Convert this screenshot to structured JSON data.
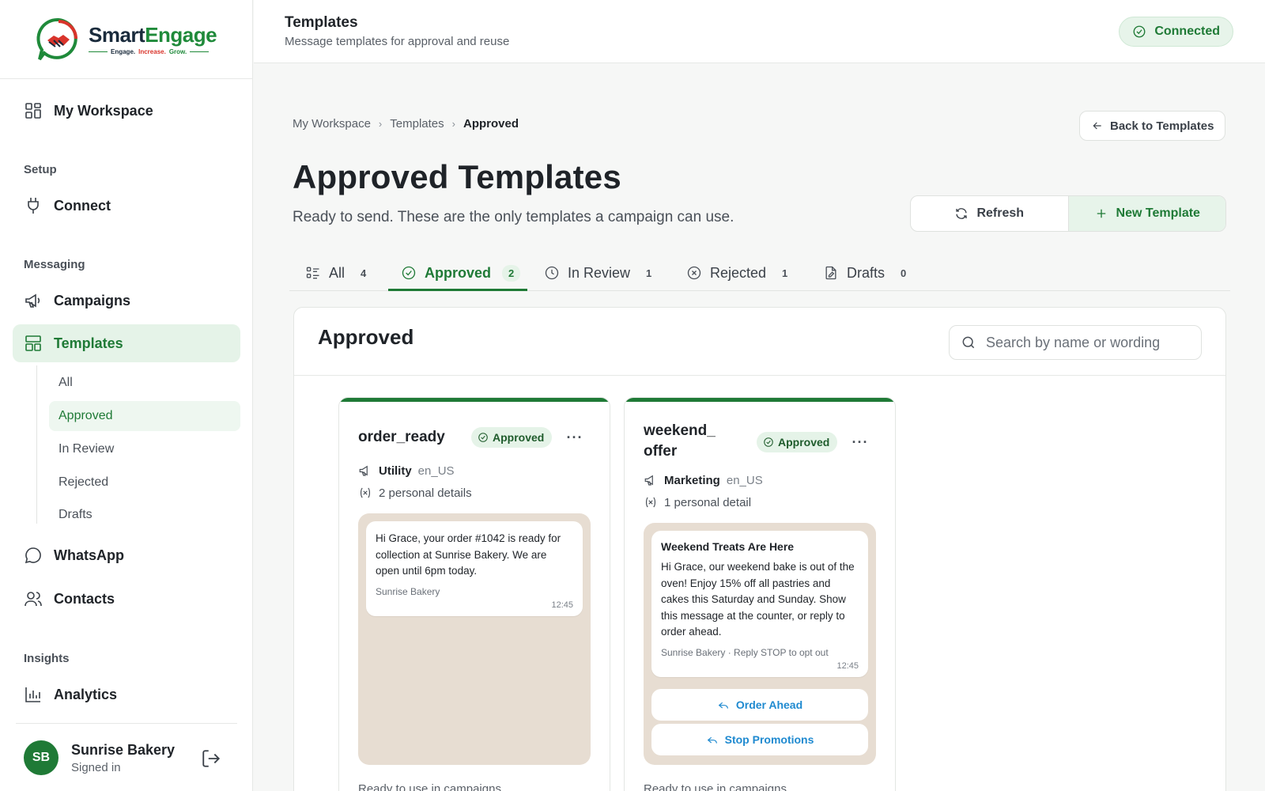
{
  "brand": {
    "name_part1": "Smart",
    "name_part2": "Engage",
    "tag_1": "Engage.",
    "tag_2": "Increase.",
    "tag_3": "Grow."
  },
  "sidebar": {
    "workspace": "My Workspace",
    "sections": {
      "setup": "Setup",
      "messaging": "Messaging",
      "insights": "Insights"
    },
    "items": {
      "connect": "Connect",
      "campaigns": "Campaigns",
      "templates": "Templates",
      "whatsapp": "WhatsApp",
      "contacts": "Contacts",
      "analytics": "Analytics"
    },
    "sub_items": [
      "All",
      "Approved",
      "In Review",
      "Rejected",
      "Drafts"
    ],
    "user": {
      "initials": "SB",
      "name": "Sunrise Bakery",
      "status": "Signed in"
    }
  },
  "header": {
    "title": "Templates",
    "subtitle": "Message templates for approval and reuse",
    "status": "Connected"
  },
  "breadcrumb": [
    "My Workspace",
    "Templates",
    "Approved"
  ],
  "back_button": "Back to Templates",
  "page": {
    "title": "Approved Templates",
    "lead": "Ready to send. These are the only templates a campaign can use."
  },
  "actions": {
    "refresh": "Refresh",
    "new_template": "New Template"
  },
  "tabs": [
    {
      "label": "All",
      "count": "4"
    },
    {
      "label": "Approved",
      "count": "2"
    },
    {
      "label": "In Review",
      "count": "1"
    },
    {
      "label": "Rejected",
      "count": "1"
    },
    {
      "label": "Drafts",
      "count": "0"
    }
  ],
  "panel": {
    "title": "Approved",
    "search_placeholder": "Search by name or wording"
  },
  "cards": [
    {
      "name": "order_ready",
      "status": "Approved",
      "category": "Utility",
      "language": "en_US",
      "variables": "2 personal details",
      "message": {
        "body": "Hi Grace, your order #1042 is ready for collection at Sunrise Bakery. We are open until 6pm today.",
        "footer": "Sunrise Bakery",
        "time": "12:45"
      },
      "footnote": "Ready to use in campaigns."
    },
    {
      "name_line1": "weekend_",
      "name_line2": "offer",
      "status": "Approved",
      "category": "Marketing",
      "language": "en_US",
      "variables": "1 personal detail",
      "message": {
        "header": "Weekend Treats Are Here",
        "body": "Hi Grace, our weekend bake is out of the oven! Enjoy 15% off all pastries and cakes this Saturday and Sunday. Show this message at the counter, or reply to order ahead.",
        "footer": "Sunrise Bakery · Reply STOP to opt out",
        "time": "12:45"
      },
      "quick_replies": [
        "Order Ahead",
        "Stop Promotions"
      ],
      "footnote": "Ready to use in campaigns."
    }
  ],
  "colors": {
    "accent": "#1f7a36",
    "accent_soft": "#e5f3e8",
    "chat_bg": "#e7ddd2",
    "link_blue": "#1f8ad0"
  }
}
